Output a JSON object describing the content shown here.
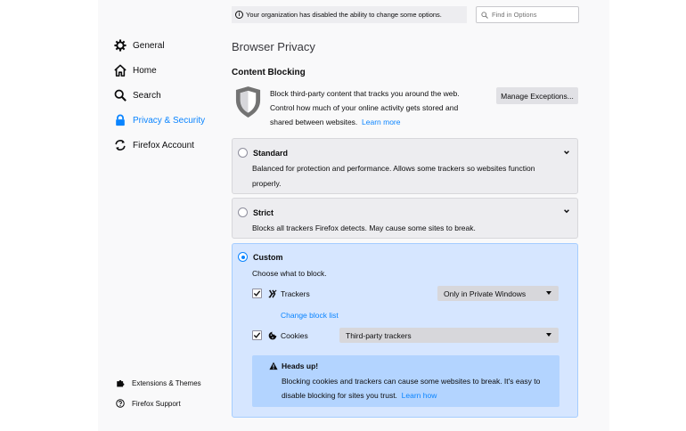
{
  "sidebar": {
    "items": [
      {
        "label": "General",
        "icon": "gear-icon"
      },
      {
        "label": "Home",
        "icon": "home-icon"
      },
      {
        "label": "Search",
        "icon": "search-icon"
      },
      {
        "label": "Privacy & Security",
        "icon": "lock-icon",
        "selected": true
      },
      {
        "label": "Firefox Account",
        "icon": "sync-icon"
      }
    ],
    "footer": [
      {
        "label": "Extensions & Themes",
        "icon": "puzzle-icon"
      },
      {
        "label": "Firefox Support",
        "icon": "help-icon"
      }
    ]
  },
  "notice": {
    "text": "Your organization has disabled the ability to change some options."
  },
  "search": {
    "placeholder": "Find in Options"
  },
  "page_title": "Browser Privacy",
  "content_blocking": {
    "title": "Content Blocking",
    "description": "Block third-party content that tracks you around the web. Control how much of your online activity gets stored and shared between websites.",
    "learn_more": "Learn more",
    "manage_button": "Manage Exceptions..."
  },
  "options": {
    "standard": {
      "label": "Standard",
      "description": "Balanced for protection and performance. Allows some trackers so websites function properly."
    },
    "strict": {
      "label": "Strict",
      "description": "Blocks all trackers Firefox detects. May cause some sites to break."
    },
    "custom": {
      "label": "Custom",
      "choose": "Choose what to block.",
      "trackers": {
        "label": "Trackers",
        "checked": true,
        "dropdown": "Only in Private Windows"
      },
      "change_block_list": "Change block list",
      "cookies": {
        "label": "Cookies",
        "checked": true,
        "dropdown": "Third-party trackers"
      },
      "heads_up": {
        "title": "Heads up!",
        "text": "Blocking cookies and trackers can cause some websites to break. It's easy to disable blocking for sites you trust.",
        "learn_how": "Learn how"
      }
    }
  },
  "colors": {
    "accent": "#0a84ff",
    "custom_bg": "#d6e6ff",
    "headsup_bg": "#b3d4ff"
  }
}
